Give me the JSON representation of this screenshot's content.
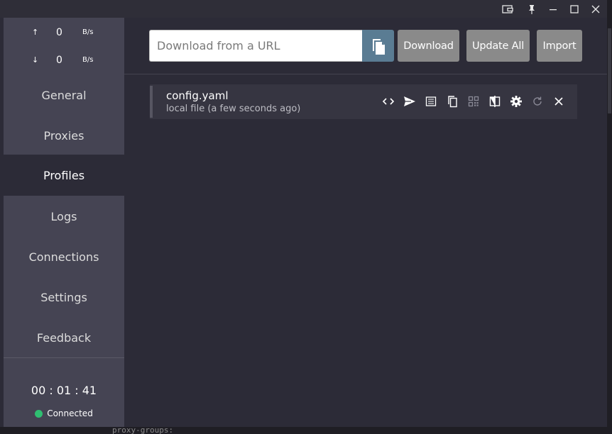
{
  "traffic": {
    "upload": {
      "arrow": "↑",
      "value": "0",
      "unit": "B/s"
    },
    "download": {
      "arrow": "↓",
      "value": "0",
      "unit": "B/s"
    }
  },
  "sidebar": {
    "items": [
      {
        "label": "General"
      },
      {
        "label": "Proxies"
      },
      {
        "label": "Profiles"
      },
      {
        "label": "Logs"
      },
      {
        "label": "Connections"
      },
      {
        "label": "Settings"
      },
      {
        "label": "Feedback"
      }
    ],
    "active": "Profiles"
  },
  "footer": {
    "uptime": "00 : 01 : 41",
    "status": "Connected",
    "status_color": "#2fbf71"
  },
  "toolbar": {
    "url_placeholder": "Download from a URL",
    "url_value": "",
    "download_label": "Download",
    "update_all_label": "Update All",
    "import_label": "Import"
  },
  "profiles": [
    {
      "name": "config.yaml",
      "source": "local file (a few seconds ago)"
    }
  ],
  "card_actions": [
    "code-icon",
    "send-icon",
    "document-icon",
    "copy-icon",
    "qr-code-icon",
    "compare-icon",
    "gear-icon",
    "refresh-icon",
    "close-icon"
  ],
  "window_controls": [
    "wallet-icon",
    "pin-icon",
    "minimize-icon",
    "maximize-icon",
    "close-icon"
  ],
  "background_text": "proxy-groups:"
}
